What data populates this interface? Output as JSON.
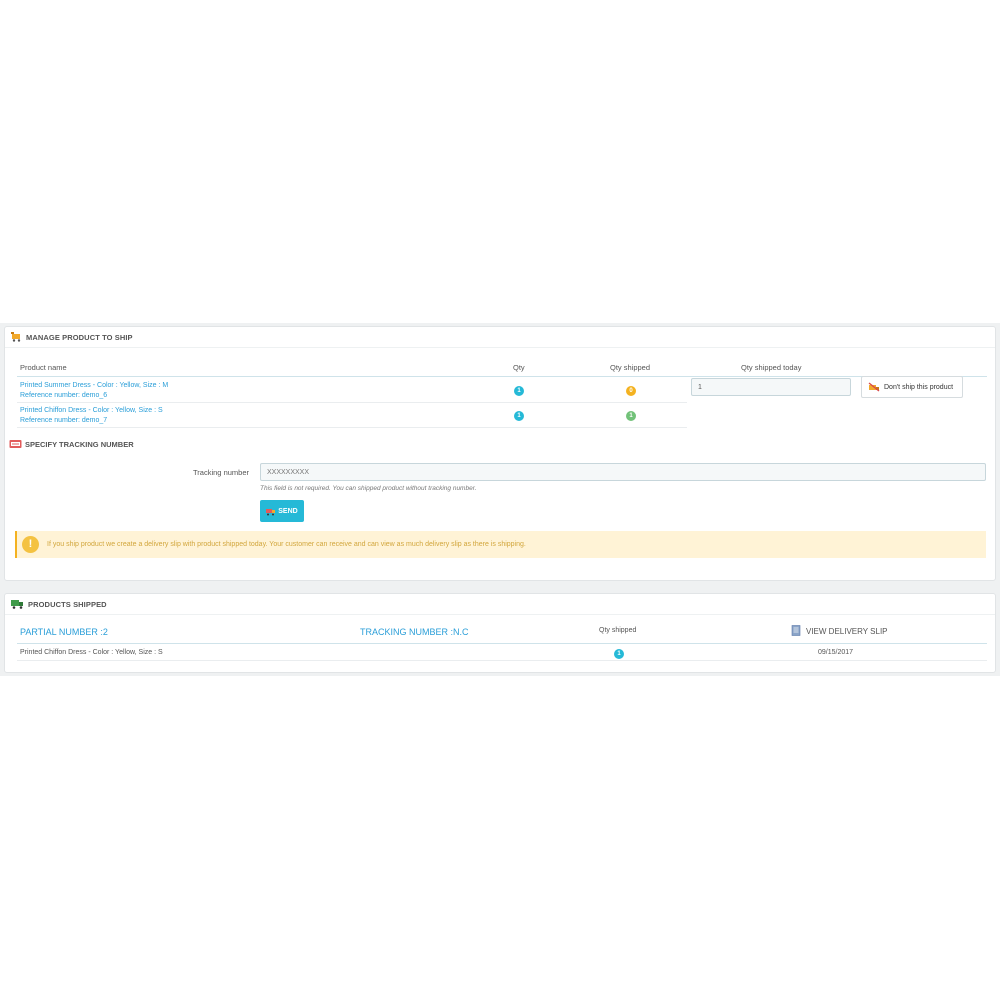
{
  "manage": {
    "title": "MANAGE PRODUCT TO SHIP",
    "columns": {
      "product_name": "Product name",
      "qty": "Qty",
      "qty_shipped": "Qty shipped",
      "qty_today": "Qty shipped today"
    },
    "rows": [
      {
        "name": "Printed Summer Dress - Color : Yellow, Size : M",
        "reference": "Reference number: demo_6",
        "qty": "1",
        "qty_shipped": "0",
        "today_value": "1",
        "dont_ship_label": "Don't ship this product"
      },
      {
        "name": "Printed Chiffon Dress - Color : Yellow, Size : S",
        "reference": "Reference number: demo_7",
        "qty": "1",
        "qty_shipped": "1"
      }
    ]
  },
  "tracking": {
    "title": "SPECIFY TRACKING NUMBER",
    "label": "Tracking number",
    "placeholder": "XXXXXXXXX",
    "help": "This field is not required. You can shipped product without tracking number.",
    "send_label": "SEND"
  },
  "alert": {
    "text": "If you ship product we create a delivery slip with product shipped today. Your customer can receive and can view as much delivery slip as there is shipping."
  },
  "shipped": {
    "title": "PRODUCTS SHIPPED",
    "partial": "PARTIAL NUMBER :2",
    "tracking": "TRACKING NUMBER :N.C",
    "qty_header": "Qty shipped",
    "view_slip": "VIEW DELIVERY SLIP",
    "row": {
      "name": "Printed Chiffon Dress - Color : Yellow, Size : S",
      "qty": "1",
      "date": "09/15/2017"
    }
  },
  "colors": {
    "accent": "#25b9d7",
    "link": "#2a9ed8",
    "warning": "#f4b220",
    "success": "#72c279"
  },
  "icons": [
    "cart-icon",
    "tracking-icon",
    "send-icon",
    "no-ship-icon",
    "truck-icon",
    "document-icon",
    "warning-icon"
  ]
}
